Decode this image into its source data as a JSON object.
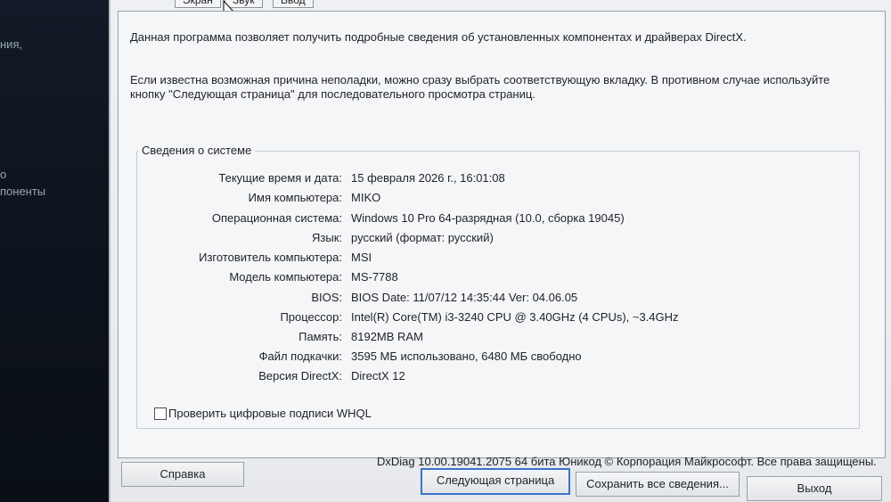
{
  "desktop": {
    "fragments": [
      "ния,",
      "о",
      "поненты"
    ]
  },
  "tabs": [
    "Экран",
    "Звук",
    "Ввод"
  ],
  "intro": {
    "line1": "Данная программа позволяет получить подробные сведения об установленных компонентах и драйверах DirectX.",
    "line2": "Если известна возможная причина неполадки, можно сразу выбрать соответствующую вкладку. В противном случае используйте",
    "line3": "кнопку \"Следующая страница\" для последовательного просмотра страниц."
  },
  "system_info": {
    "title": "Сведения о системе",
    "rows": [
      {
        "label": "Текущие время и дата:",
        "value": "15 февраля 2026 г., 16:01:08"
      },
      {
        "label": "Имя компьютера:",
        "value": "MIKO"
      },
      {
        "label": "Операционная система:",
        "value": "Windows 10 Pro 64-разрядная (10.0, сборка 19045)"
      },
      {
        "label": "Язык:",
        "value": "русский (формат: русский)"
      },
      {
        "label": "Изготовитель компьютера:",
        "value": "MSI"
      },
      {
        "label": "Модель компьютера:",
        "value": "MS-7788"
      },
      {
        "label": "BIOS:",
        "value": "BIOS Date: 11/07/12 14:35:44 Ver: 04.06.05"
      },
      {
        "label": "Процессор:",
        "value": "Intel(R) Core(TM) i3-3240 CPU @ 3.40GHz (4 CPUs), ~3.4GHz"
      },
      {
        "label": "Память:",
        "value": "8192MB RAM"
      },
      {
        "label": "Файл подкачки:",
        "value": "3595 МБ использовано, 6480 МБ свободно"
      },
      {
        "label": "Версия DirectX:",
        "value": "DirectX 12"
      }
    ]
  },
  "whql_label": "Проверить цифровые подписи WHQL",
  "footer": "DxDiag 10.00.19041.2075 64 бита Юникод © Корпорация Майкрософт. Все права защищены.",
  "buttons": {
    "help": "Справка",
    "next": "Следующая страница",
    "save": "Сохранить все сведения...",
    "exit": "Выход"
  }
}
